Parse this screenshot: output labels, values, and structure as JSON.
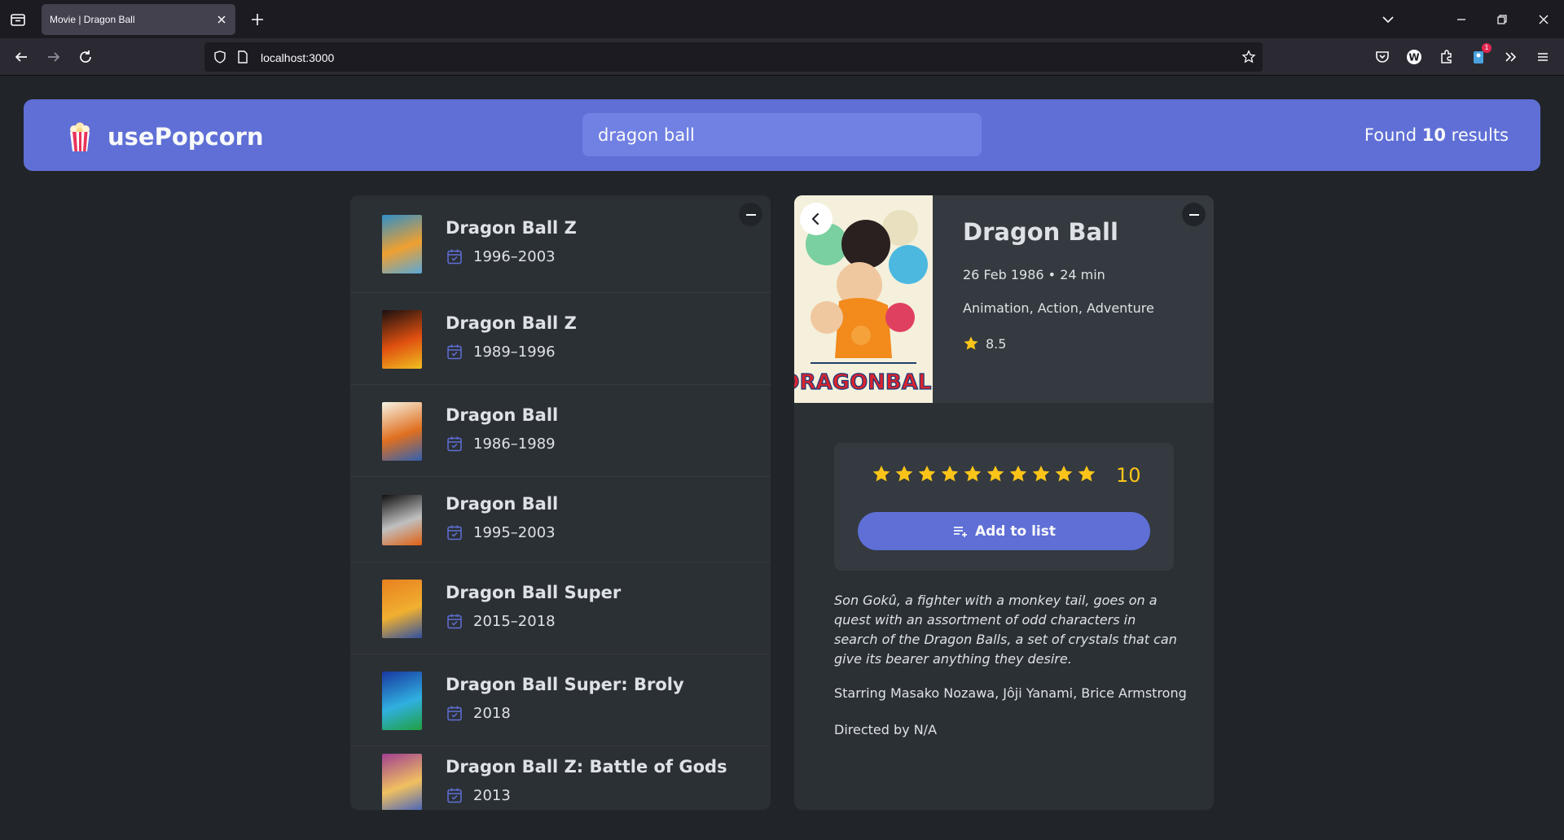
{
  "browser": {
    "tab_title": "Movie | Dragon Ball",
    "url": "localhost:3000",
    "extension_badge": "1"
  },
  "app": {
    "logo_text": "usePopcorn",
    "search_value": "dragon ball",
    "results_prefix": "Found",
    "results_count": "10",
    "results_suffix": "results"
  },
  "movies": [
    {
      "title": "Dragon Ball Z",
      "year": "1996–2003",
      "poster_colors": [
        "#2e8fc9",
        "#f0a030",
        "#58a8d8"
      ]
    },
    {
      "title": "Dragon Ball Z",
      "year": "1989–1996",
      "poster_colors": [
        "#1a1010",
        "#e05010",
        "#f0c020"
      ]
    },
    {
      "title": "Dragon Ball",
      "year": "1986–1989",
      "poster_colors": [
        "#f6f2e2",
        "#e07020",
        "#3060b0"
      ]
    },
    {
      "title": "Dragon Ball",
      "year": "1995–2003",
      "poster_colors": [
        "#101010",
        "#c0c0c0",
        "#e06010"
      ]
    },
    {
      "title": "Dragon Ball Super",
      "year": "2015–2018",
      "poster_colors": [
        "#e88020",
        "#f0b030",
        "#3050a0"
      ]
    },
    {
      "title": "Dragon Ball Super: Broly",
      "year": "2018",
      "poster_colors": [
        "#1838a0",
        "#30b0e0",
        "#20a040"
      ]
    },
    {
      "title": "Dragon Ball Z: Battle of Gods",
      "year": "2013",
      "poster_colors": [
        "#a04090",
        "#f0c060",
        "#4060c0"
      ]
    }
  ],
  "details": {
    "title": "Dragon Ball",
    "meta": "26 Feb 1986 • 24 min",
    "genre": "Animation, Action, Adventure",
    "imdb_rating": "8.5",
    "user_rating": "10",
    "star_count": 10,
    "add_button": "Add to list",
    "plot": "Son Gokû, a fighter with a monkey tail, goes on a quest with an assortment of odd characters in search of the Dragon Balls, a set of crystals that can give its bearer anything they desire.",
    "starring": "Starring Masako Nozawa, Jôji Yanami, Brice Armstrong",
    "directed": "Directed by N/A",
    "poster_logo": "DRAGONBALL"
  },
  "colors": {
    "primary": "#5f6fd6",
    "star": "#fcc419",
    "background": "#212529"
  }
}
